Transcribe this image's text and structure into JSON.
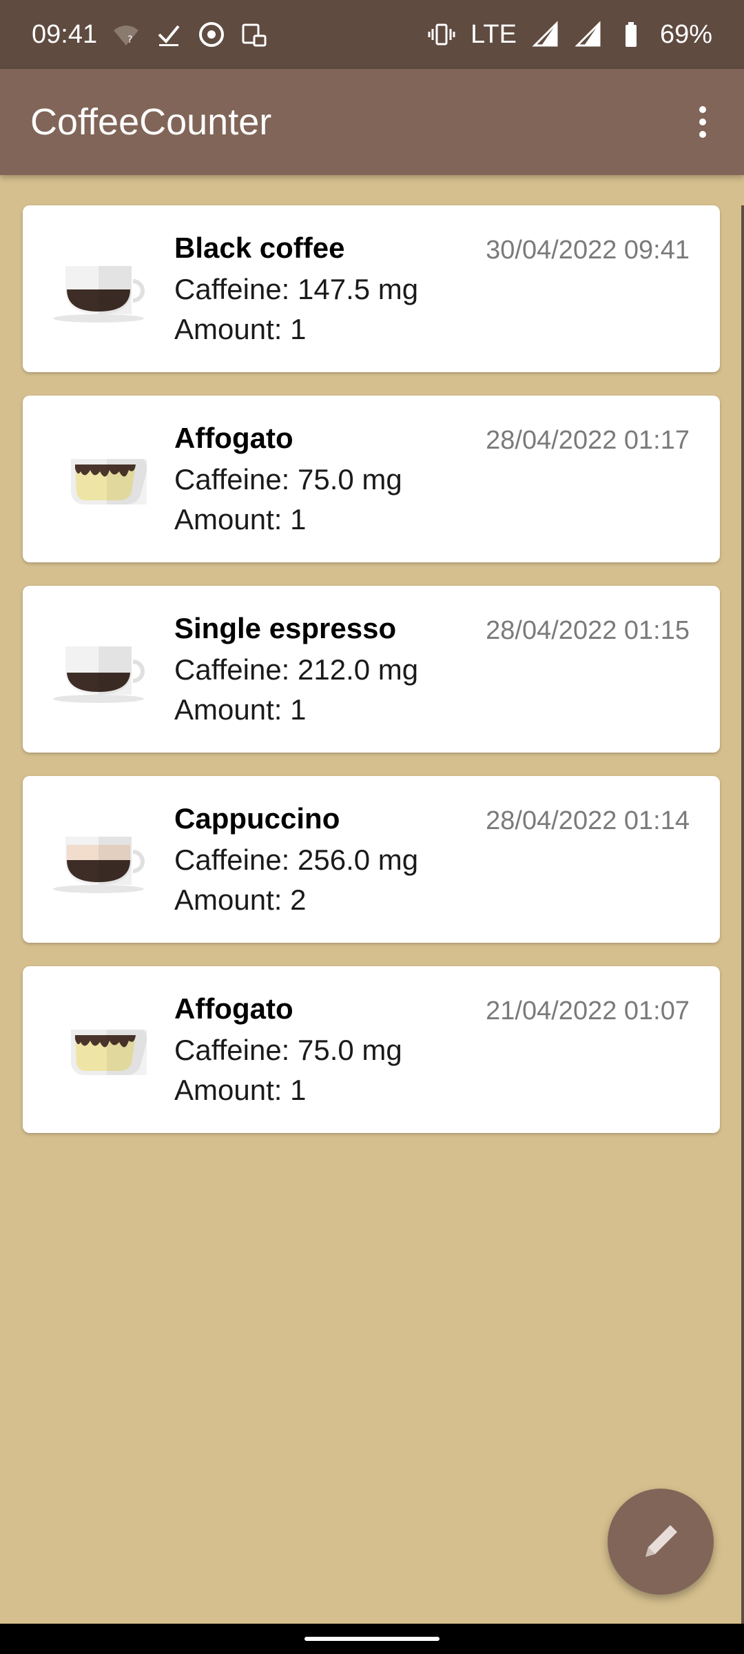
{
  "status_bar": {
    "time": "09:41",
    "network": "LTE",
    "battery": "69%",
    "icons": [
      "wifi-question-icon",
      "check-icon",
      "chrome-icon",
      "cast-icon",
      "vibrate-icon",
      "signal-icon",
      "signal-icon",
      "battery-icon"
    ]
  },
  "app_bar": {
    "title": "CoffeeCounter",
    "menu_icon": "more-vert-icon"
  },
  "entries": [
    {
      "name": "Black coffee",
      "caffeine": "Caffeine: 147.5 mg",
      "amount": "Amount: 1",
      "date": "30/04/2022 09:41",
      "icon": "black-coffee-cup-icon"
    },
    {
      "name": "Affogato",
      "caffeine": "Caffeine: 75.0 mg",
      "amount": "Amount: 1",
      "date": "28/04/2022 01:17",
      "icon": "affogato-glass-icon"
    },
    {
      "name": "Single espresso",
      "caffeine": "Caffeine: 212.0 mg",
      "amount": "Amount: 1",
      "date": "28/04/2022 01:15",
      "icon": "espresso-cup-icon"
    },
    {
      "name": "Cappuccino",
      "caffeine": "Caffeine: 256.0 mg",
      "amount": "Amount: 2",
      "date": "28/04/2022 01:14",
      "icon": "cappuccino-cup-icon"
    },
    {
      "name": "Affogato",
      "caffeine": "Caffeine: 75.0 mg",
      "amount": "Amount: 1",
      "date": "21/04/2022 01:07",
      "icon": "affogato-glass-icon"
    }
  ],
  "fab": {
    "icon": "pencil-icon"
  },
  "colors": {
    "status_bar": "#5f4b40",
    "app_bar": "#806558",
    "background": "#d5bf8e",
    "card": "#ffffff",
    "date_text": "#7a7a7a"
  }
}
